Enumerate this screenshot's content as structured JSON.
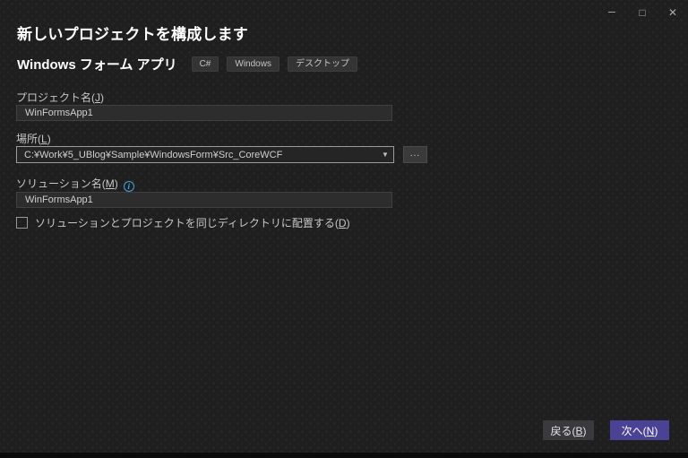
{
  "window": {
    "controls": {
      "minimize_icon": "–",
      "maximize_icon": "□",
      "close_icon": "✕"
    }
  },
  "header": {
    "title": "新しいプロジェクトを構成します"
  },
  "template": {
    "name": "Windows フォーム アプリ",
    "tags": [
      "C#",
      "Windows",
      "デスクトップ"
    ]
  },
  "form": {
    "project_name": {
      "label_prefix": "プロジェクト名(",
      "mnemonic": "J",
      "label_suffix": ")",
      "value": "WinFormsApp1"
    },
    "location": {
      "label_prefix": "場所(",
      "mnemonic": "L",
      "label_suffix": ")",
      "value": "C:¥Work¥5_UBlog¥Sample¥WindowsForm¥Src_CoreWCF",
      "dropdown_icon": "▼",
      "browse_label": "..."
    },
    "solution_name": {
      "label_prefix": "ソリューション名(",
      "mnemonic": "M",
      "label_suffix": ")",
      "info_icon": "i",
      "value": "WinFormsApp1"
    },
    "same_directory_checkbox": {
      "checked": false,
      "label_prefix": "ソリューションとプロジェクトを同じディレクトリに配置する(",
      "mnemonic": "D",
      "label_suffix": ")"
    }
  },
  "footer": {
    "back_button": {
      "label_prefix": "戻る(",
      "mnemonic": "B",
      "label_suffix": ")"
    },
    "next_button": {
      "label_prefix": "次へ(",
      "mnemonic": "N",
      "label_suffix": ")"
    }
  },
  "colors": {
    "accent": "#4a4294",
    "info_blue": "#41a3dd",
    "dialog_background": "#1f1f1f"
  }
}
